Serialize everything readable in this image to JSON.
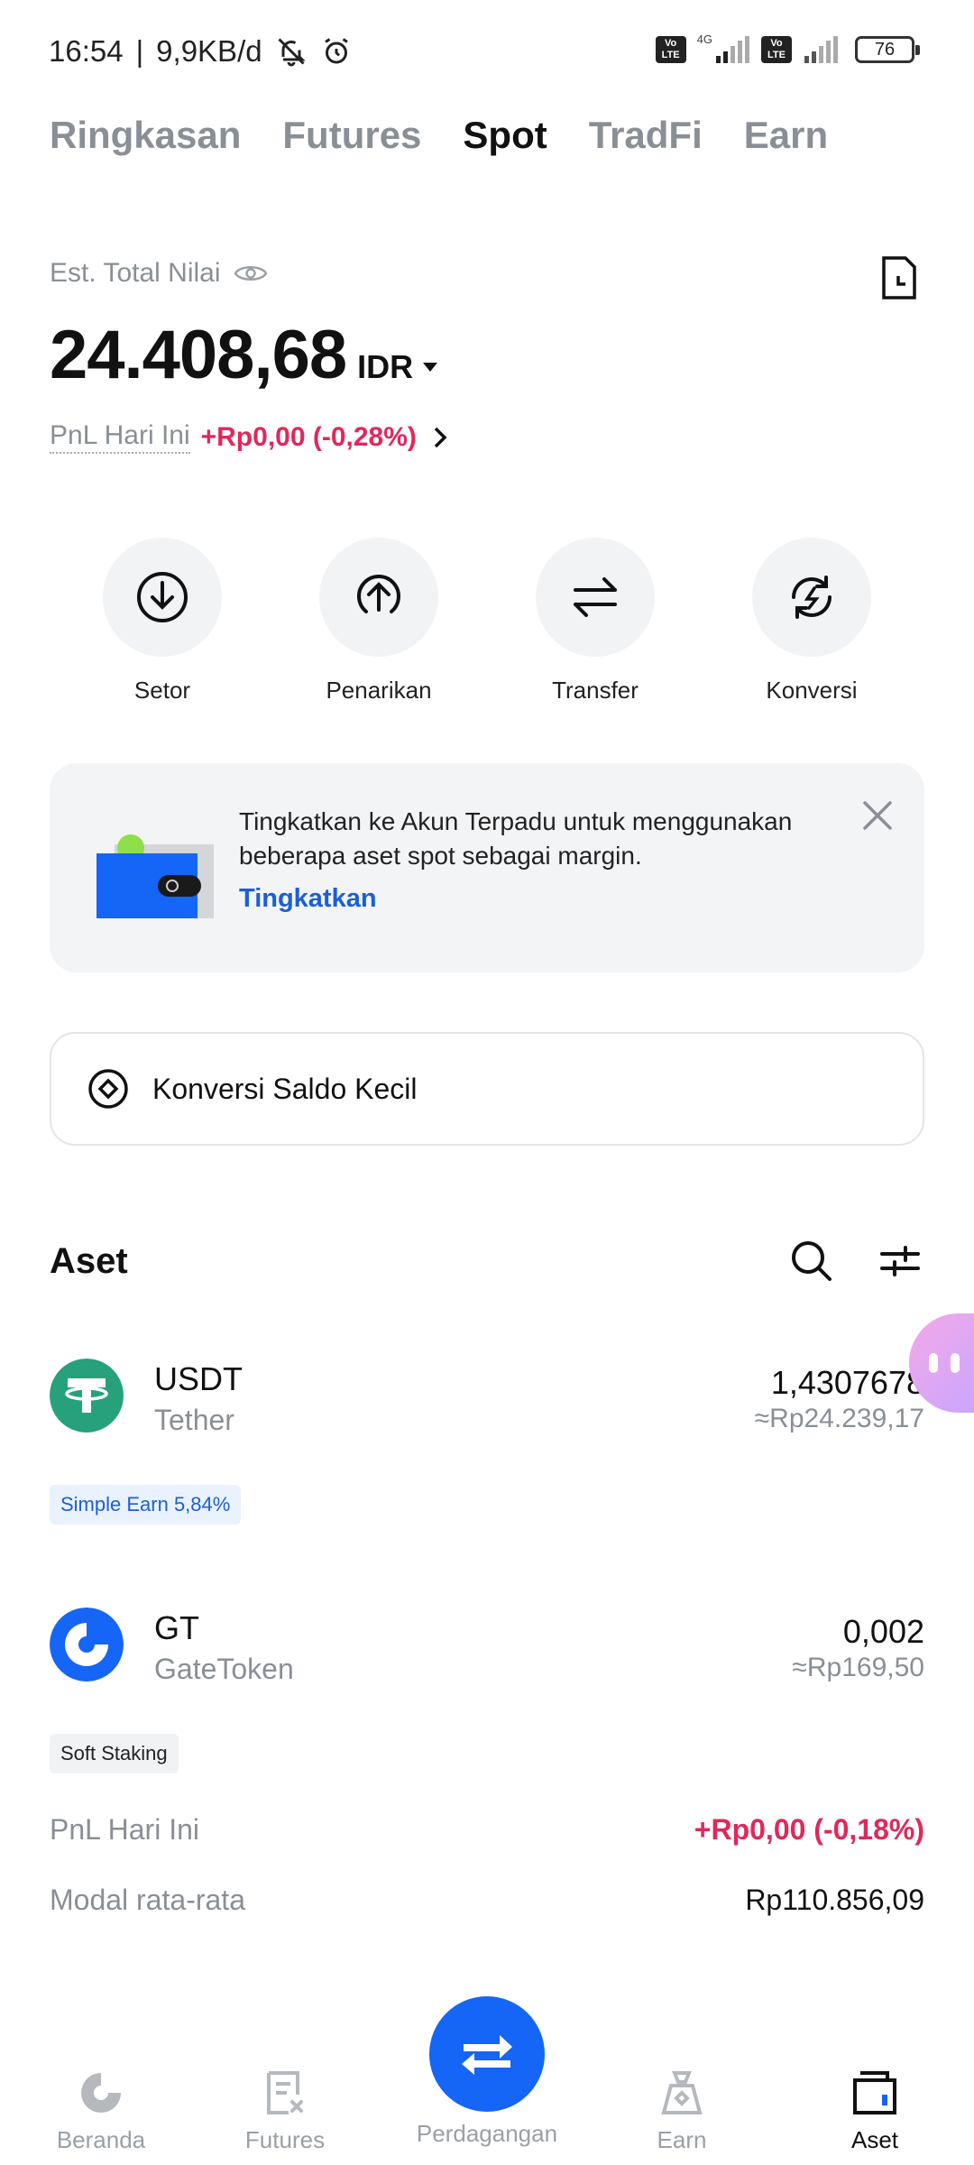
{
  "status_bar": {
    "time": "16:54",
    "speed": "9,9KB/d",
    "volte1": "Vo LTE",
    "net": "4G",
    "volte2": "Vo LTE",
    "battery": "76",
    "icons": [
      "bell-off-icon",
      "alarm-icon",
      "signal-icon",
      "battery-icon"
    ]
  },
  "tabs": [
    {
      "label": "Ringkasan",
      "active": false
    },
    {
      "label": "Futures",
      "active": false
    },
    {
      "label": "Spot",
      "active": true
    },
    {
      "label": "TradFi",
      "active": false
    },
    {
      "label": "Earn",
      "active": false
    }
  ],
  "summary": {
    "est_label": "Est. Total Nilai",
    "total": "24.408,68",
    "currency": "IDR",
    "pnl_label": "PnL Hari Ini",
    "pnl_value": "+Rp0,00 (-0,28%)"
  },
  "actions": [
    {
      "label": "Setor",
      "icon": "download-icon"
    },
    {
      "label": "Penarikan",
      "icon": "upload-icon"
    },
    {
      "label": "Transfer",
      "icon": "transfer-icon"
    },
    {
      "label": "Konversi",
      "icon": "convert-icon"
    }
  ],
  "banner": {
    "text": "Tingkatkan ke Akun Terpadu untuk menggunakan beberapa aset spot sebagai margin.",
    "link": "Tingkatkan"
  },
  "small_balance": {
    "label": "Konversi Saldo Kecil"
  },
  "assets": {
    "title": "Aset",
    "items": [
      {
        "symbol": "USDT",
        "name": "Tether",
        "amount": "1,4307678",
        "idr": "≈Rp24.239,17",
        "tag": "Simple Earn 5,84%"
      },
      {
        "symbol": "GT",
        "name": "GateToken",
        "amount": "0,002",
        "idr": "≈Rp169,50",
        "tag": "Soft Staking"
      }
    ],
    "details": [
      {
        "label": "PnL Hari Ini",
        "value": "+Rp0,00 (-0,18%)"
      },
      {
        "label": "Modal rata-rata",
        "value": "Rp110.856,09"
      }
    ]
  },
  "bottom_nav": [
    {
      "label": "Beranda",
      "icon": "home-icon",
      "active": false
    },
    {
      "label": "Futures",
      "icon": "futures-icon",
      "active": false
    },
    {
      "label": "Perdagangan",
      "icon": "trade-icon",
      "active": false
    },
    {
      "label": "Earn",
      "icon": "earn-icon",
      "active": false
    },
    {
      "label": "Aset",
      "icon": "wallet-icon",
      "active": true
    }
  ],
  "colors": {
    "accent": "#1565f6",
    "pnl_red": "#e0285a",
    "muted": "#8a8f96",
    "usdt": "#26a17b",
    "gt": "#1565f6"
  }
}
